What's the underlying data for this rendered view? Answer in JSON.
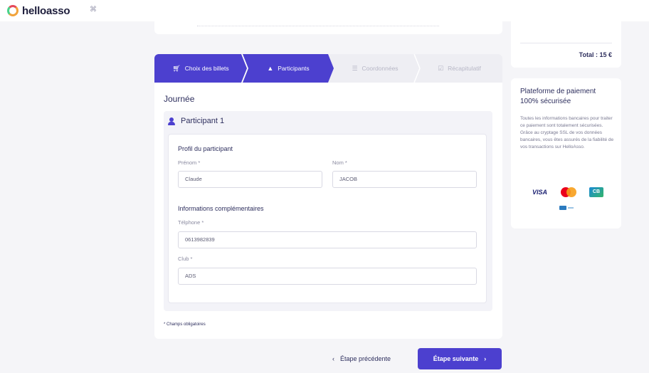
{
  "header": {
    "logo_text": "helloasso"
  },
  "stepper": {
    "steps": [
      {
        "label": "Choix des billets",
        "state": "done"
      },
      {
        "label": "Participants",
        "state": "active"
      },
      {
        "label": "Coordonnées",
        "state": "upcoming"
      },
      {
        "label": "Récapitulatif",
        "state": "upcoming"
      }
    ]
  },
  "form": {
    "section_title": "Journée",
    "participant_title": "Participant 1",
    "profile_heading": "Profil du participant",
    "prenom_label": "Prénom *",
    "prenom_value": "Claude",
    "nom_label": "Nom *",
    "nom_value": "JACOB",
    "extra_heading": "Informations complémentaires",
    "phone_label": "Télphone *",
    "phone_value": "0613982839",
    "club_label": "Club *",
    "club_value": "ADS",
    "required_note": "* Champs obligatoires"
  },
  "navigation": {
    "prev_label": "Étape précédente",
    "next_label": "Étape suivante"
  },
  "summary": {
    "total_label": "Total : 15 €"
  },
  "secure": {
    "title": "Plateforme de paiement 100% sécurisée",
    "text": "Toutes les informations bancaires pour traiter ce paiement sont totalement sécurisées. Grâce au cryptage SSL de vos données bancaires, vous êtes assurés de la fiabilité de vos transactions sur HelloAsso.",
    "visa_label": "VISA"
  },
  "colors": {
    "accent": "#4c40cf",
    "background": "#f5f5f8"
  }
}
